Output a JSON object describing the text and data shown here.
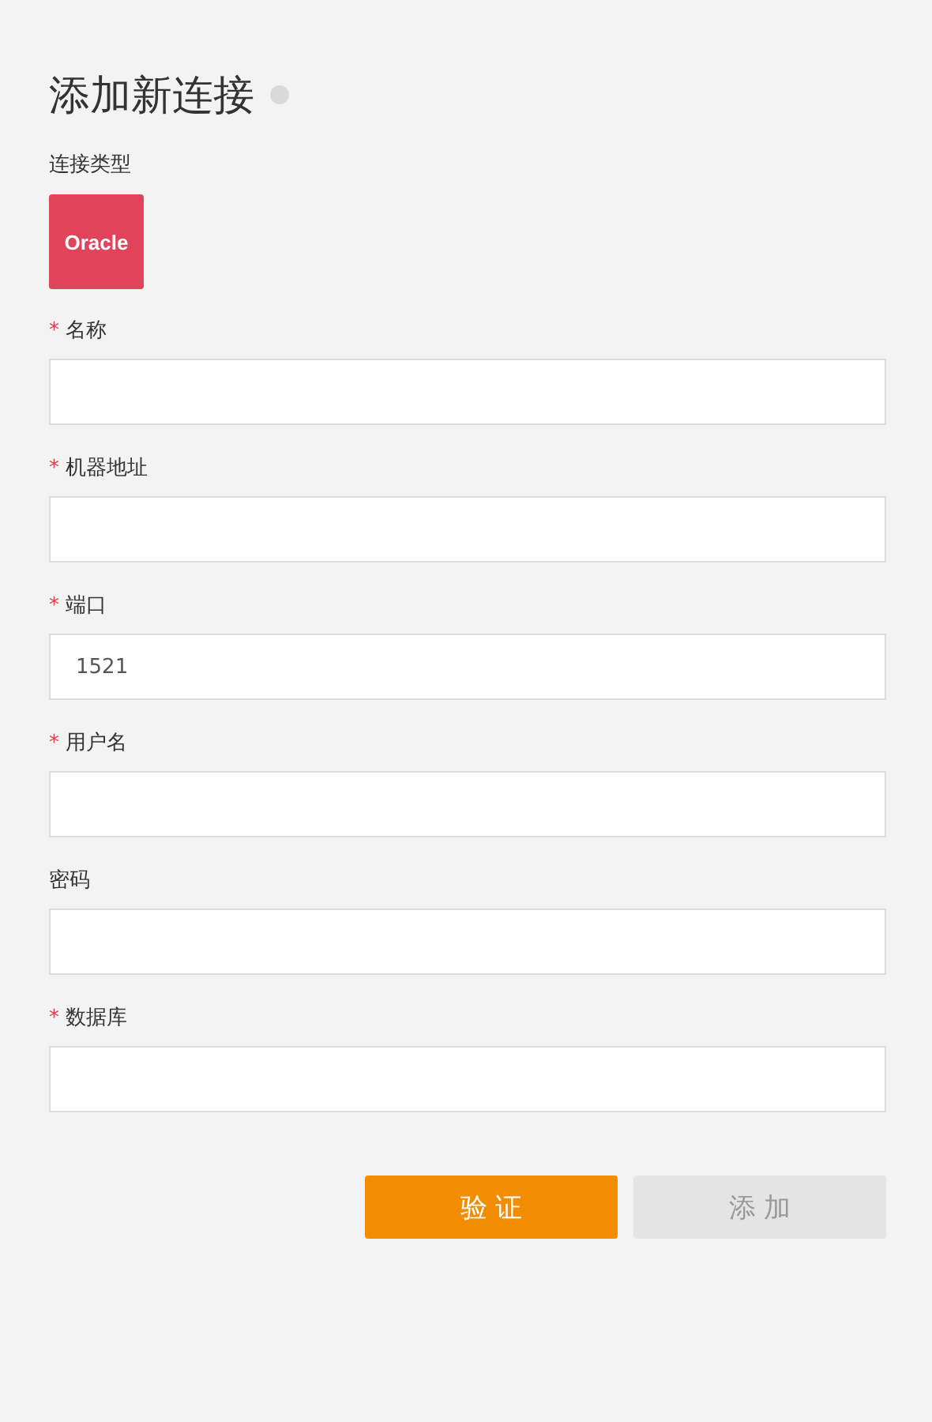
{
  "title": "添加新连接",
  "connection_type": {
    "label": "连接类型",
    "logo": "Oracle"
  },
  "fields": [
    {
      "label": "名称",
      "required": true
    },
    {
      "label": "机器地址",
      "required": true
    },
    {
      "label": "端口",
      "required": true,
      "value": "1521"
    },
    {
      "label": "用户名",
      "required": true
    },
    {
      "label": "密码",
      "required": false
    },
    {
      "label": "数据库",
      "required": true
    }
  ],
  "required_mark": "*",
  "buttons": [
    {
      "label": "验 证",
      "kind": "primary",
      "disabled": false
    },
    {
      "label": "添 加",
      "kind": "secondary",
      "disabled": true
    }
  ]
}
